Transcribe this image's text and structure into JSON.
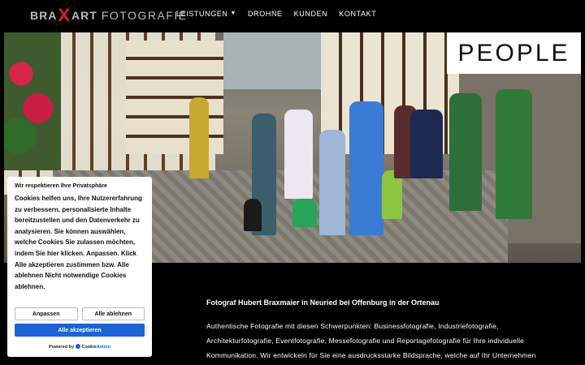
{
  "logo": {
    "part1": "BRA",
    "part2": "X",
    "part3": "ART",
    "part4": "FOTOGRAFIE"
  },
  "nav": {
    "items": [
      {
        "label": "LEISTUNGEN",
        "has_dropdown": true
      },
      {
        "label": "DROHNE"
      },
      {
        "label": "KUNDEN"
      },
      {
        "label": "KONTAKT"
      }
    ]
  },
  "hero": {
    "badge": "PEOPLE"
  },
  "main": {
    "heading": "Fotograf Hubert Braxmaier in Neuried bei Offenburg in der Ortenau",
    "paragraph": "Authentische Fotografie mit diesen Schwerpunkten: Businessfotografie, Industriefotografie, Architekturfotografie, Eventfotografie, Messefotografie und Reportagefotografie für Ihre individuelle Kommunikation. Wir entwickeln für Sie eine ausdrucksstarke Bildsprache, welche auf Ihr Unternehmen"
  },
  "cookie": {
    "title": "Wir respektieren Ihre Privatsphäre",
    "text": "Cookies helfen uns, Ihre Nutzererfahrung zu verbessern, personalisierte Inhalte bereitzustellen und den Datenverkehr zu analysieren. Sie können auswählen, welche Cookies Sie zulassen möchten, indem Sie hier klicken. Anpassen. Klick Alle akzeptieren zustimmen bzw. Alle ablehnen Nicht notwendige Cookies ablehnen.",
    "customize_label": "Anpassen",
    "reject_label": "Alle ablehnen",
    "accept_label": "Alle akzeptieren",
    "powered_by": "Powered by",
    "powered_brand_1": "Cookie",
    "powered_brand_2": "Admin"
  },
  "colors": {
    "accent": "#e01b24",
    "accept_button": "#1b63d6",
    "background": "#000000"
  }
}
